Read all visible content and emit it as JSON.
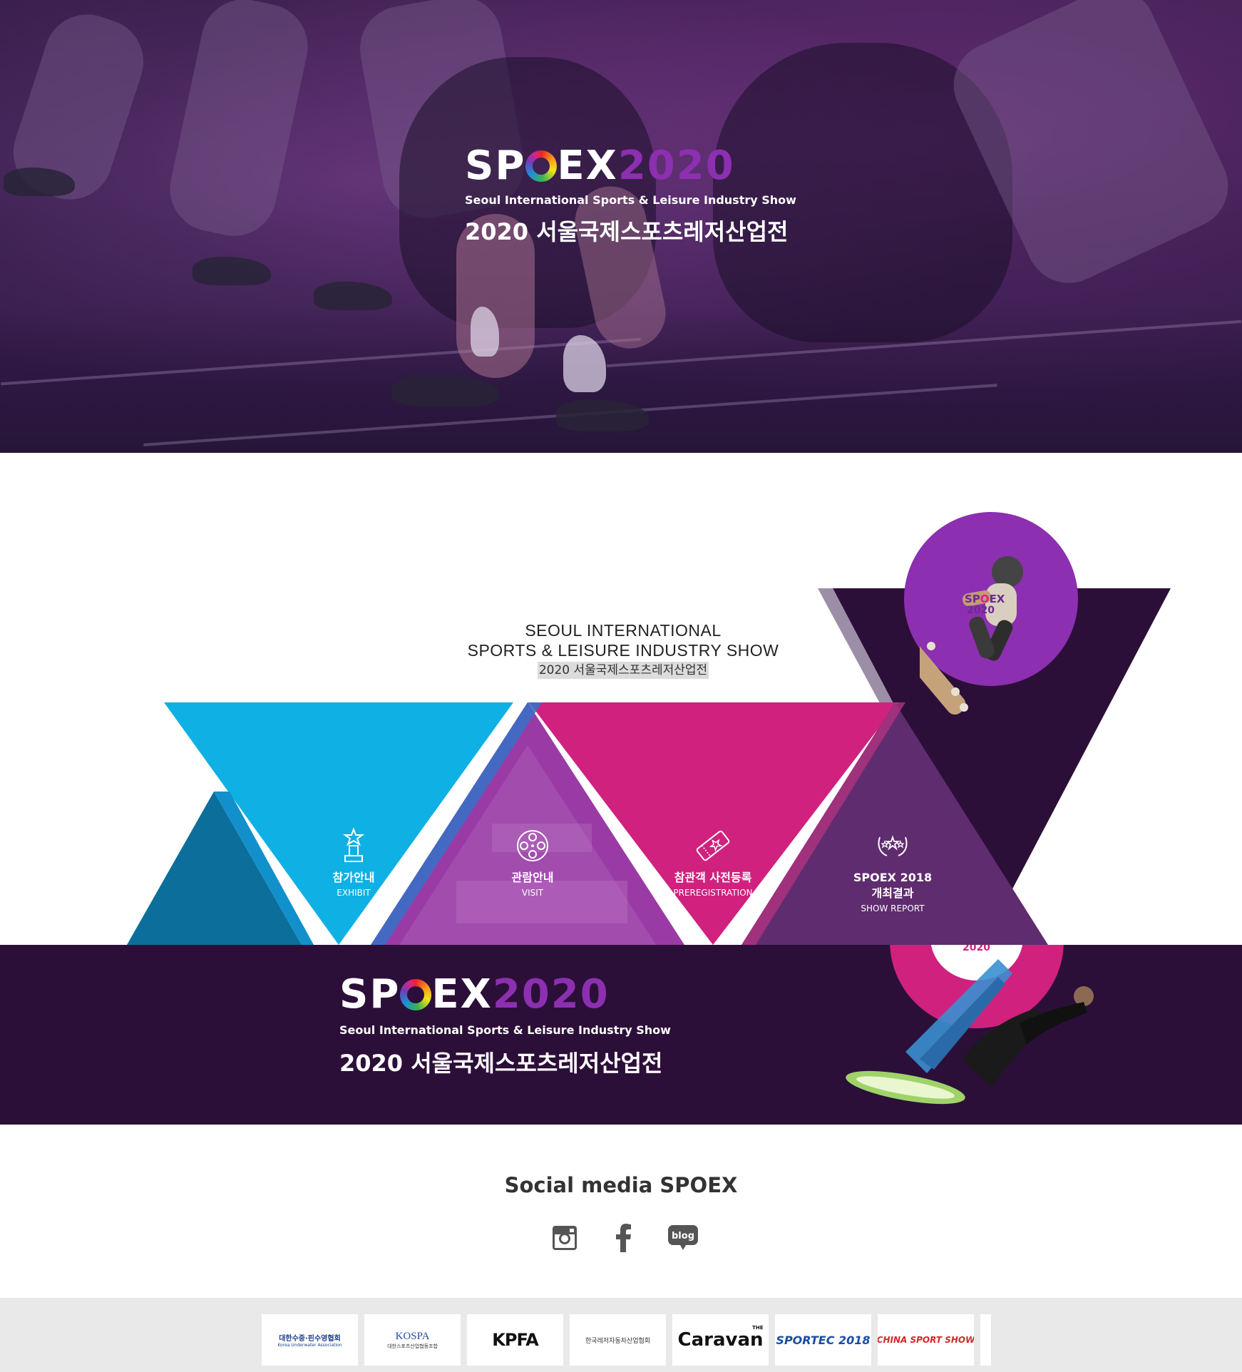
{
  "hero": {
    "logo_sp": "SP",
    "logo_ex": "EX",
    "logo_year": "2020",
    "subtitle": "Seoul International Sports & Leisure Industry Show",
    "korean_title": "2020 서울국제스포츠레저산업전"
  },
  "intro": {
    "line1": "SEOUL INTERNATIONAL",
    "line2": "SPORTS & LEISURE INDUSTRY SHOW",
    "line3": "2020 서울국제스포츠레저산업전",
    "skater_badge_sp": "SP",
    "skater_badge_ex": "EX",
    "skater_badge_year": "2020"
  },
  "menu": [
    {
      "kor": "참가안내",
      "eng": "EXHIBIT",
      "icon": "trophy-icon"
    },
    {
      "kor": "관람안내",
      "eng": "VISIT",
      "icon": "film-reel-icon"
    },
    {
      "kor": "참관객 사전등록",
      "eng": "PREREGISTRATION",
      "icon": "ticket-icon"
    },
    {
      "kor_line1": "SPOEX 2018",
      "kor_line2": "개최결과",
      "eng": "SHOW REPORT",
      "icon": "laurel-stars-icon"
    }
  ],
  "banner": {
    "logo_sp": "SP",
    "logo_ex": "EX",
    "logo_year": "2020",
    "subtitle": "Seoul International Sports & Leisure Industry Show",
    "korean_title": "2020 서울국제스포츠레저산업전",
    "circle_year": "2020"
  },
  "social": {
    "title": "Social media SPOEX",
    "links": [
      {
        "name": "instagram",
        "icon": "instagram-icon"
      },
      {
        "name": "facebook",
        "icon": "facebook-icon"
      },
      {
        "name": "blog",
        "icon": "blog-icon",
        "label": "blog"
      }
    ]
  },
  "partners": [
    {
      "label": "대한수중·핀수영협회",
      "sub": "Korea Underwater Association"
    },
    {
      "label": "KOSPA",
      "sub": "대한스포츠산업협동조합"
    },
    {
      "label": "KPFA",
      "sub": ""
    },
    {
      "label": "한국레저자동차산업협회",
      "sub": ""
    },
    {
      "label": "Caravan",
      "sub": "THE"
    },
    {
      "label": "SPORTEC 2018",
      "sub": ""
    },
    {
      "label": "CHINA SPORT SHOW",
      "sub": ""
    }
  ],
  "colors": {
    "hero_purple": "#3b1f4e",
    "logo_purple": "#8c2fb0",
    "cyan": "#0fb0e4",
    "magenta": "#d0217e",
    "deep_purple": "#2c0f38",
    "violet": "#7b3a94"
  }
}
